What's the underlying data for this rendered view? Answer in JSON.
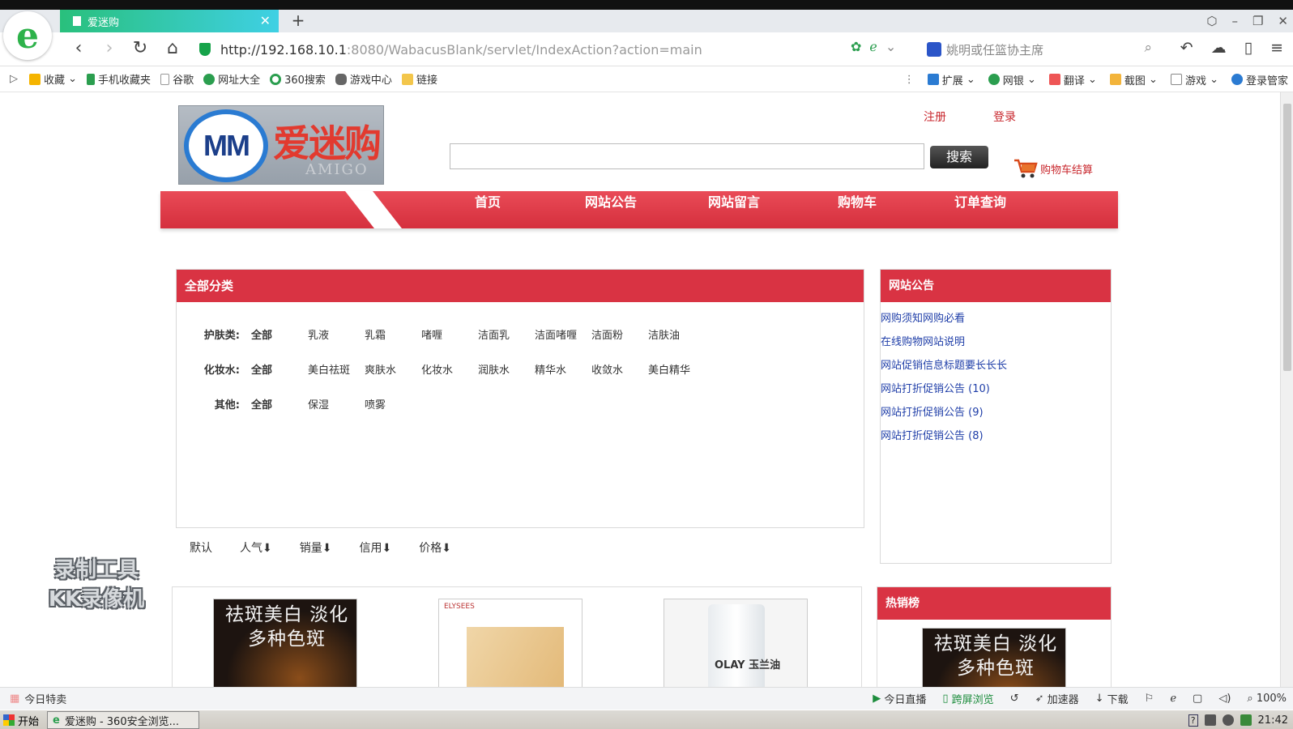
{
  "browser": {
    "tab_title": "爱迷购",
    "tab_close": "✕",
    "new_tab": "+",
    "url_host": "http://192.168.10.1",
    "url_path": ":8080/WabacusBlank/servlet/IndexAction?action=main",
    "search_placeholder": "姚明或任篮协主席",
    "favorites": [
      "收藏",
      "手机收藏夹",
      "谷歌",
      "网址大全",
      "360搜索",
      "游戏中心",
      "链接"
    ],
    "tools": [
      "扩展",
      "网银",
      "翻译",
      "截图",
      "游戏",
      "登录管家"
    ]
  },
  "header": {
    "logo_mm": "MM",
    "logo_cn": "爱迷购",
    "logo_en": "AMIGO",
    "register": "注册",
    "login": "登录",
    "search_value": "",
    "search_button": "搜索",
    "cart_link": "购物车结算"
  },
  "menu": [
    "首页",
    "网站公告",
    "网站留言",
    "购物车",
    "订单查询"
  ],
  "categories": {
    "title": "全部分类",
    "rows": [
      {
        "label": "护肤类:",
        "all": "全部",
        "items": [
          "乳液",
          "乳霜",
          "啫喱",
          "洁面乳",
          "洁面啫喱",
          "洁面粉",
          "洁肤油"
        ]
      },
      {
        "label": "化妆水:",
        "all": "全部",
        "items": [
          "美白祛斑",
          "爽肤水",
          "化妆水",
          "润肤水",
          "精华水",
          "收敛水",
          "美白精华"
        ]
      },
      {
        "label": "其他:",
        "all": "全部",
        "items": [
          "保湿",
          "喷雾"
        ]
      }
    ]
  },
  "sort": [
    "默认",
    "人气⬇",
    "销量⬇",
    "信用⬇",
    "价格⬇"
  ],
  "notice": {
    "title": "网站公告",
    "items": [
      "网购须知网购必看",
      "在线购物网站说明",
      "网站促销信息标题要长长长",
      "网站打折促销公告 (10)",
      "网站打折促销公告 (9)",
      "网站打折促销公告 (8)"
    ]
  },
  "products": {
    "p1_text": "祛斑美白 淡化多种色斑",
    "p2_brand": "ELYSEES",
    "p3_brand": "OLAY 玉兰油"
  },
  "hot": {
    "title": "热销榜",
    "img_text": "祛斑美白 淡化多种色斑"
  },
  "watermark": [
    "录制工具",
    "KK录像机"
  ],
  "status": {
    "left": "今日特卖",
    "items": [
      "今日直播",
      "跨屏浏览",
      "加速器",
      "下载"
    ],
    "zoom": "100%"
  },
  "taskbar": {
    "start": "开始",
    "task": "爱迷购 - 360安全浏览...",
    "time": "21:42"
  }
}
